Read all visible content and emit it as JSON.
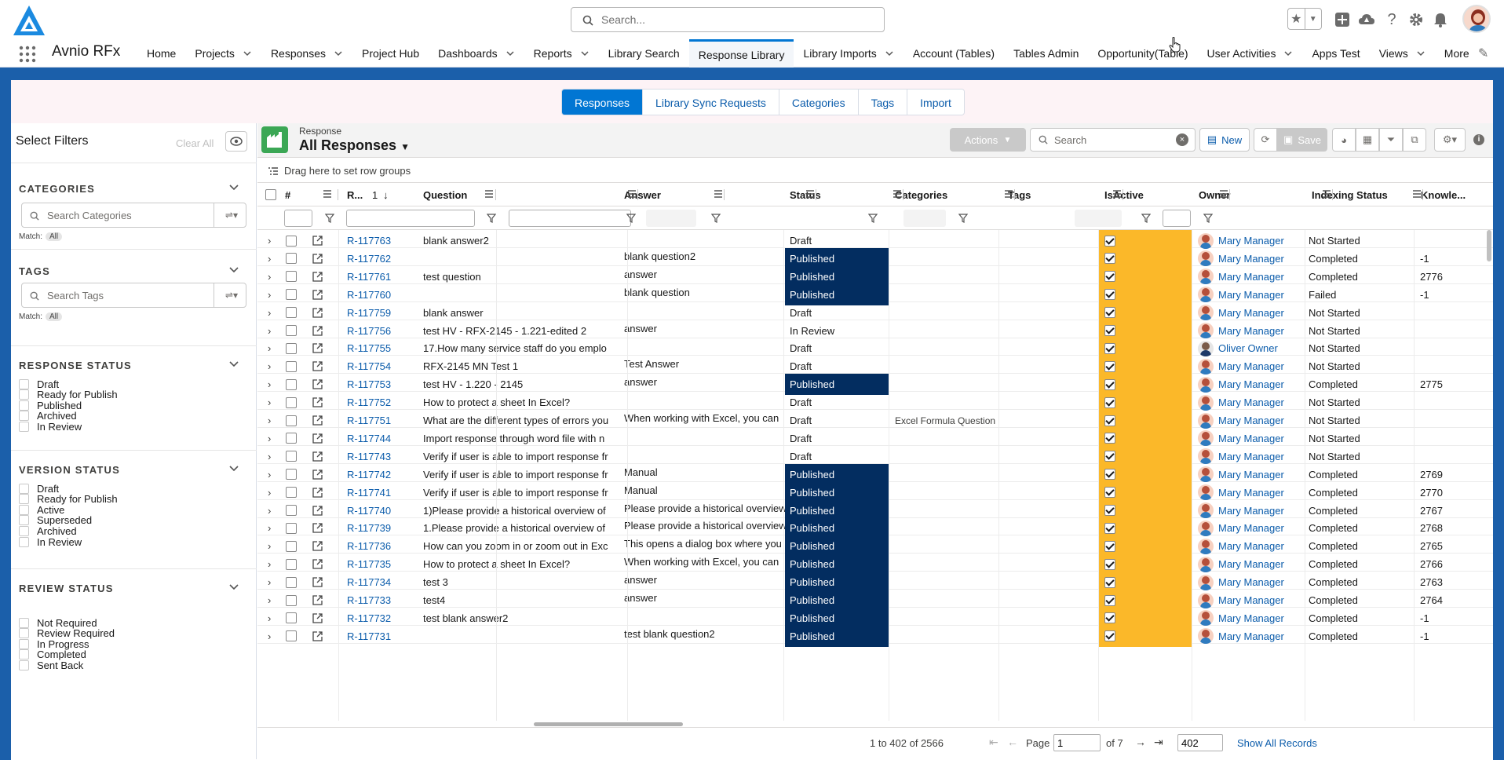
{
  "app": {
    "name": "Avnio RFx",
    "search_placeholder": "Search..."
  },
  "nav": [
    {
      "label": "Home",
      "chevron": false
    },
    {
      "label": "Projects",
      "chevron": true
    },
    {
      "label": "Responses",
      "chevron": true
    },
    {
      "label": "Project Hub",
      "chevron": false
    },
    {
      "label": "Dashboards",
      "chevron": true
    },
    {
      "label": "Reports",
      "chevron": true
    },
    {
      "label": "Library Search",
      "chevron": false
    },
    {
      "label": "Response Library",
      "chevron": false,
      "active": true
    },
    {
      "label": "Library Imports",
      "chevron": true
    },
    {
      "label": "Account (Tables)",
      "chevron": false
    },
    {
      "label": "Tables Admin",
      "chevron": false
    },
    {
      "label": "Opportunity(Table)",
      "chevron": false
    },
    {
      "label": "User Activities",
      "chevron": true
    },
    {
      "label": "Apps Test",
      "chevron": false
    },
    {
      "label": "Views",
      "chevron": true
    },
    {
      "label": "More",
      "chevron": false
    }
  ],
  "subtabs": [
    "Responses",
    "Library Sync Requests",
    "Categories",
    "Tags",
    "Import"
  ],
  "filters": {
    "title": "Select Filters",
    "clear_all": "Clear All",
    "match_label": "Match:",
    "match_value": "All",
    "categories": {
      "header": "CATEGORIES",
      "placeholder": "Search Categories"
    },
    "tags": {
      "header": "TAGS",
      "placeholder": "Search Tags"
    },
    "response_status": {
      "header": "RESPONSE STATUS",
      "options": [
        "Draft",
        "Ready for Publish",
        "Published",
        "Archived",
        "In Review"
      ]
    },
    "version_status": {
      "header": "VERSION STATUS",
      "options": [
        "Draft",
        "Ready for Publish",
        "Active",
        "Superseded",
        "Archived",
        "In Review"
      ]
    },
    "review_status": {
      "header": "REVIEW STATUS",
      "options": [
        "Not Required",
        "Review Required",
        "In Progress",
        "Completed",
        "Sent Back"
      ]
    }
  },
  "grid": {
    "object_label": "Response",
    "view_title": "All Responses",
    "actions_label": "Actions",
    "search_placeholder": "Search",
    "new_label": "New",
    "save_label": "Save",
    "row_group_hint": "Drag here to set row groups",
    "columns": {
      "hash": "#",
      "id": "R...",
      "sort_index": "1",
      "question": "Question",
      "answer": "Answer",
      "status": "Status",
      "categories": "Categories",
      "tags": "Tags",
      "isactive": "IsActive",
      "owner": "Owner",
      "indexing": "Indexing Status",
      "knowledge": "Knowle..."
    },
    "rows": [
      {
        "id": "R-117763",
        "question": "blank answer2",
        "answer": "",
        "status": "Draft",
        "categories": "",
        "owner": "Mary Manager",
        "indexing": "Not Started",
        "knowledge": ""
      },
      {
        "id": "R-117762",
        "question": "",
        "answer": "blank question2",
        "status": "Published",
        "categories": "",
        "owner": "Mary Manager",
        "indexing": "Completed",
        "knowledge": "-1"
      },
      {
        "id": "R-117761",
        "question": "test question",
        "answer": "answer",
        "status": "Published",
        "categories": "",
        "owner": "Mary Manager",
        "indexing": "Completed",
        "knowledge": "2776"
      },
      {
        "id": "R-117760",
        "question": "",
        "answer": "blank question",
        "status": "Published",
        "categories": "",
        "owner": "Mary Manager",
        "indexing": "Failed",
        "knowledge": "-1"
      },
      {
        "id": "R-117759",
        "question": "blank answer",
        "answer": "",
        "status": "Draft",
        "categories": "",
        "owner": "Mary Manager",
        "indexing": "Not Started",
        "knowledge": ""
      },
      {
        "id": "R-117756",
        "question": "test HV - RFX-2145 - 1.221-edited 2",
        "answer": "answer",
        "status": "In Review",
        "categories": "",
        "owner": "Mary Manager",
        "indexing": "Not Started",
        "knowledge": ""
      },
      {
        "id": "R-117755",
        "question": "17.How many service staff do you emplo",
        "answer": "",
        "status": "Draft",
        "categories": "",
        "owner": "Oliver Owner",
        "indexing": "Not Started",
        "knowledge": ""
      },
      {
        "id": "R-117754",
        "question": "RFX-2145 MN Test 1",
        "answer": "Test Answer",
        "status": "Draft",
        "categories": "",
        "owner": "Mary Manager",
        "indexing": "Not Started",
        "knowledge": ""
      },
      {
        "id": "R-117753",
        "question": "test HV - 1.220 - 2145",
        "answer": "answer",
        "status": "Published",
        "categories": "",
        "owner": "Mary Manager",
        "indexing": "Completed",
        "knowledge": "2775"
      },
      {
        "id": "R-117752",
        "question": "How to protect a sheet In Excel?",
        "answer": "",
        "status": "Draft",
        "categories": "",
        "owner": "Mary Manager",
        "indexing": "Not Started",
        "knowledge": ""
      },
      {
        "id": "R-117751",
        "question": "What are the different types of errors you",
        "answer": "When working with Excel, you can",
        "status": "Draft",
        "categories": "Excel Formula Question",
        "owner": "Mary Manager",
        "indexing": "Not Started",
        "knowledge": ""
      },
      {
        "id": "R-117744",
        "question": "Import response through word file with n",
        "answer": "",
        "status": "Draft",
        "categories": "",
        "owner": "Mary Manager",
        "indexing": "Not Started",
        "knowledge": ""
      },
      {
        "id": "R-117743",
        "question": "Verify if user is able to import response fr",
        "answer": "",
        "status": "Draft",
        "categories": "",
        "owner": "Mary Manager",
        "indexing": "Not Started",
        "knowledge": ""
      },
      {
        "id": "R-117742",
        "question": "Verify if user is able to import response fr",
        "answer": "Manual",
        "status": "Published",
        "categories": "",
        "owner": "Mary Manager",
        "indexing": "Completed",
        "knowledge": "2769"
      },
      {
        "id": "R-117741",
        "question": "Verify if user is able to import response fr",
        "answer": "Manual",
        "status": "Published",
        "categories": "",
        "owner": "Mary Manager",
        "indexing": "Completed",
        "knowledge": "2770"
      },
      {
        "id": "R-117740",
        "question": "1)Please provide a historical overview of",
        "answer": "Please provide a historical overview",
        "status": "Published",
        "categories": "",
        "owner": "Mary Manager",
        "indexing": "Completed",
        "knowledge": "2767"
      },
      {
        "id": "R-117739",
        "question": "1.Please provide a historical overview of",
        "answer": "Please provide a historical overview",
        "status": "Published",
        "categories": "",
        "owner": "Mary Manager",
        "indexing": "Completed",
        "knowledge": "2768"
      },
      {
        "id": "R-117736",
        "question": "How can you zoom in or zoom out in Exc",
        "answer": "This opens a dialog box where you",
        "status": "Published",
        "categories": "",
        "owner": "Mary Manager",
        "indexing": "Completed",
        "knowledge": "2765"
      },
      {
        "id": "R-117735",
        "question": "How to protect a sheet In Excel?",
        "answer": "When working with Excel, you can",
        "status": "Published",
        "categories": "",
        "owner": "Mary Manager",
        "indexing": "Completed",
        "knowledge": "2766"
      },
      {
        "id": "R-117734",
        "question": "test 3",
        "answer": "answer",
        "status": "Published",
        "categories": "",
        "owner": "Mary Manager",
        "indexing": "Completed",
        "knowledge": "2763"
      },
      {
        "id": "R-117733",
        "question": "test4",
        "answer": "answer",
        "status": "Published",
        "categories": "",
        "owner": "Mary Manager",
        "indexing": "Completed",
        "knowledge": "2764"
      },
      {
        "id": "R-117732",
        "question": "test blank answer2",
        "answer": "",
        "status": "Published",
        "categories": "",
        "owner": "Mary Manager",
        "indexing": "Completed",
        "knowledge": "-1"
      },
      {
        "id": "R-117731",
        "question": "",
        "answer": "test blank question2",
        "status": "Published",
        "categories": "",
        "owner": "Mary Manager",
        "indexing": "Completed",
        "knowledge": "-1"
      }
    ]
  },
  "footer": {
    "range": "1 to 402 of 2566",
    "page_label": "Page",
    "page_value": "1",
    "of_label": "of 7",
    "page_size": "402",
    "show_all": "Show All Records"
  },
  "colors": {
    "brand_blue": "#1b5faa",
    "accent": "#0176d3",
    "published": "#032d60",
    "isactive": "#fbb829"
  }
}
